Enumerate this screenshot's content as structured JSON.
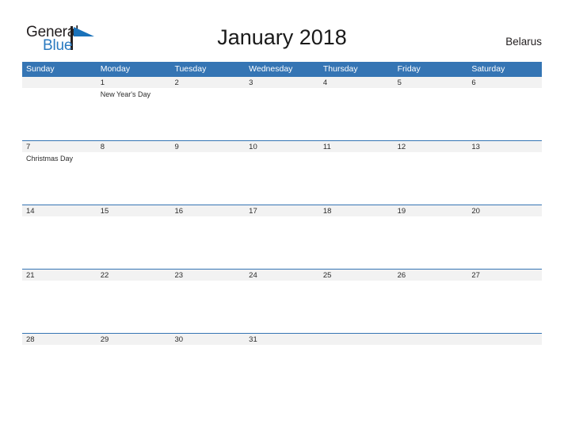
{
  "brand": {
    "name_part1": "General",
    "name_part2": "Blue",
    "mark_icon": "blue-flag-triangle-icon",
    "color_primary": "#2a7ac0",
    "color_text": "#231f20"
  },
  "header": {
    "title": "January 2018",
    "country": "Belarus"
  },
  "calendar": {
    "header_bg": "#3575b4",
    "date_strip_bg": "#f2f2f2",
    "weekdays": [
      "Sunday",
      "Monday",
      "Tuesday",
      "Wednesday",
      "Thursday",
      "Friday",
      "Saturday"
    ],
    "weeks": [
      [
        {
          "date": "",
          "event": ""
        },
        {
          "date": "1",
          "event": "New Year's Day"
        },
        {
          "date": "2",
          "event": ""
        },
        {
          "date": "3",
          "event": ""
        },
        {
          "date": "4",
          "event": ""
        },
        {
          "date": "5",
          "event": ""
        },
        {
          "date": "6",
          "event": ""
        }
      ],
      [
        {
          "date": "7",
          "event": "Christmas Day"
        },
        {
          "date": "8",
          "event": ""
        },
        {
          "date": "9",
          "event": ""
        },
        {
          "date": "10",
          "event": ""
        },
        {
          "date": "11",
          "event": ""
        },
        {
          "date": "12",
          "event": ""
        },
        {
          "date": "13",
          "event": ""
        }
      ],
      [
        {
          "date": "14",
          "event": ""
        },
        {
          "date": "15",
          "event": ""
        },
        {
          "date": "16",
          "event": ""
        },
        {
          "date": "17",
          "event": ""
        },
        {
          "date": "18",
          "event": ""
        },
        {
          "date": "19",
          "event": ""
        },
        {
          "date": "20",
          "event": ""
        }
      ],
      [
        {
          "date": "21",
          "event": ""
        },
        {
          "date": "22",
          "event": ""
        },
        {
          "date": "23",
          "event": ""
        },
        {
          "date": "24",
          "event": ""
        },
        {
          "date": "25",
          "event": ""
        },
        {
          "date": "26",
          "event": ""
        },
        {
          "date": "27",
          "event": ""
        }
      ],
      [
        {
          "date": "28",
          "event": ""
        },
        {
          "date": "29",
          "event": ""
        },
        {
          "date": "30",
          "event": ""
        },
        {
          "date": "31",
          "event": ""
        },
        {
          "date": "",
          "event": ""
        },
        {
          "date": "",
          "event": ""
        },
        {
          "date": "",
          "event": ""
        }
      ]
    ]
  }
}
